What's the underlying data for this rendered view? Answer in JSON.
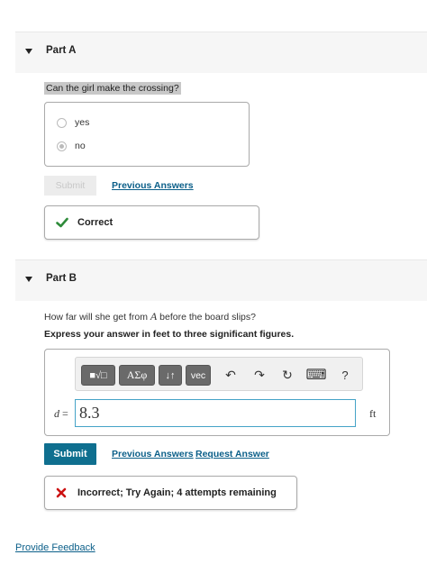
{
  "partA": {
    "title": "Part A",
    "question": "Can the girl make the crossing?",
    "choices": [
      {
        "label": "yes",
        "selected": false
      },
      {
        "label": "no",
        "selected": true
      }
    ],
    "submit_label": "Submit",
    "previous_answers": "Previous Answers",
    "feedback": "Correct",
    "feedback_color": "#2e8b3a"
  },
  "partB": {
    "title": "Part B",
    "question_prefix": "How far will she get from",
    "question_var": "A",
    "question_suffix": "before the board slips?",
    "instruction": "Express your answer in feet to three significant figures.",
    "toolbar": {
      "templates": "■√□",
      "greek": "AΣφ",
      "arrows": "↓↑",
      "vec": "vec",
      "undo_icon": "↶",
      "redo_icon": "↷",
      "reset_icon": "↻",
      "keyboard_icon": "⌨",
      "help": "?"
    },
    "variable": "d",
    "equals": "=",
    "answer_value": "8.3",
    "unit": "ft",
    "submit_label": "Submit",
    "previous_answers": "Previous Answers",
    "request_answer": "Request Answer",
    "feedback": "Incorrect; Try Again; 4 attempts remaining",
    "feedback_color": "#cc1111",
    "accent_color": "#0f6f8f"
  },
  "footer": {
    "provide_feedback": "Provide Feedback"
  }
}
